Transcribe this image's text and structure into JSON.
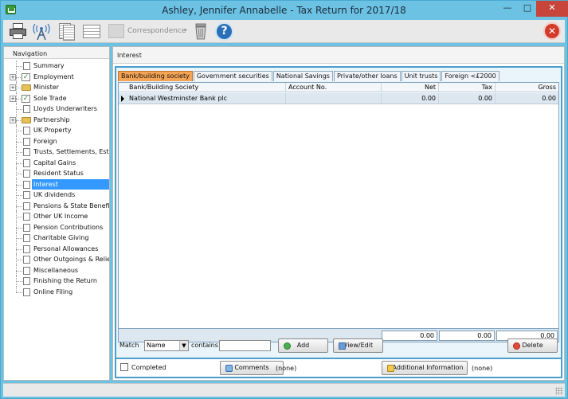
{
  "window": {
    "title": "Ashley, Jennifer Annabelle - Tax Return for 2017/18",
    "minimize_glyph": "—",
    "maximize_glyph": "□",
    "close_glyph": "✕"
  },
  "toolbar": {
    "correspondence_label": "Correspondence",
    "correspondence_arrow": "▾",
    "help_glyph": "?",
    "exit_glyph": "✕"
  },
  "nav": {
    "header": "Navigation",
    "items": [
      {
        "label": "Summary",
        "icon": "document-icon"
      },
      {
        "label": "Employment",
        "icon": "check-icon",
        "expandable": true
      },
      {
        "label": "Minister",
        "icon": "folder-icon",
        "expandable": true
      },
      {
        "label": "Sole Trade",
        "icon": "check-icon",
        "expandable": true
      },
      {
        "label": "Lloyds Underwriters",
        "icon": "document-icon"
      },
      {
        "label": "Partnership",
        "icon": "folder-icon",
        "expandable": true
      },
      {
        "label": "UK Property",
        "icon": "document-icon"
      },
      {
        "label": "Foreign",
        "icon": "document-icon"
      },
      {
        "label": "Trusts, Settlements, Est...",
        "icon": "document-icon"
      },
      {
        "label": "Capital Gains",
        "icon": "document-icon"
      },
      {
        "label": "Resident Status",
        "icon": "document-icon"
      },
      {
        "label": "Interest",
        "icon": "document-icon",
        "selected": true
      },
      {
        "label": "UK dividends",
        "icon": "document-icon"
      },
      {
        "label": "Pensions & State Benefits",
        "icon": "document-icon"
      },
      {
        "label": "Other UK Income",
        "icon": "document-icon"
      },
      {
        "label": "Pension Contributions",
        "icon": "document-icon"
      },
      {
        "label": "Charitable Giving",
        "icon": "document-icon"
      },
      {
        "label": "Personal Allowances",
        "icon": "document-icon"
      },
      {
        "label": "Other Outgoings & Relie...",
        "icon": "document-icon"
      },
      {
        "label": "Miscellaneous",
        "icon": "document-icon"
      },
      {
        "label": "Finishing the Return",
        "icon": "document-icon"
      },
      {
        "label": "Online Filing",
        "icon": "document-icon"
      }
    ],
    "expander_glyph": "+"
  },
  "main": {
    "header": "Interest",
    "tabs": [
      {
        "label": "Bank/building society",
        "active": true
      },
      {
        "label": "Government securities"
      },
      {
        "label": "National Savings"
      },
      {
        "label": "Private/other loans"
      },
      {
        "label": "Unit trusts"
      },
      {
        "label": "Foreign <£2000"
      }
    ],
    "grid": {
      "columns": [
        "Bank/Building Society",
        "Account No.",
        "Net",
        "Tax",
        "Gross"
      ],
      "rows": [
        {
          "bank": "National Westminster Bank plc",
          "account": "",
          "net": "0.00",
          "tax": "0.00",
          "gross": "0.00"
        }
      ],
      "totals": {
        "net": "0.00",
        "tax": "0.00",
        "gross": "0.00"
      }
    },
    "filter": {
      "match_label": "Match",
      "field_value": "Name",
      "dropdown_glyph": "▼",
      "contains_label": "contains",
      "contains_value": ""
    },
    "buttons": {
      "add": "Add",
      "view_edit": "View/Edit",
      "delete": "Delete"
    },
    "footer": {
      "completed_label": "Completed",
      "comments_button": "Comments",
      "comments_status": "(none)",
      "additional_button": "Additional Information",
      "additional_status": "(none)"
    }
  }
}
